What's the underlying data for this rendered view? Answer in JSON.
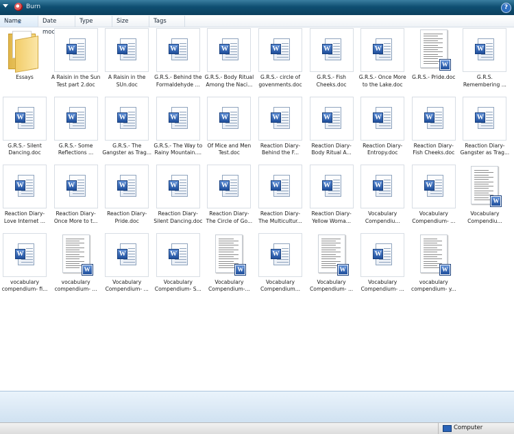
{
  "window": {
    "title": "Burn",
    "help_label": "?"
  },
  "columns": [
    "Name",
    "Date modif...",
    "Type",
    "Size",
    "Tags"
  ],
  "files": [
    {
      "name": "Essays",
      "icon": "folder-icon"
    },
    {
      "name": "A Raisin in the Sun Test part 2.doc",
      "icon": "word-doc-icon"
    },
    {
      "name": "A Raisin in the SUn.doc",
      "icon": "word-doc-icon"
    },
    {
      "name": "G.R.S.- Behind the Formaldehyde ...",
      "icon": "word-doc-icon"
    },
    {
      "name": "G.R.S.- Body Ritual Among the Naci...",
      "icon": "word-doc-icon"
    },
    {
      "name": "G.R.S.- circle of govenments.doc",
      "icon": "word-doc-icon"
    },
    {
      "name": "G.R.S.- Fish Cheeks.doc",
      "icon": "word-doc-icon"
    },
    {
      "name": "G.R.S.- Once More to the Lake.doc",
      "icon": "word-doc-icon"
    },
    {
      "name": "G.R.S.- Pride.doc",
      "icon": "doc-preview-icon"
    },
    {
      "name": "G.R.S. Remembering ...",
      "icon": "word-doc-icon"
    },
    {
      "name": "G.R.S.- Silent Dancing.doc",
      "icon": "word-doc-icon"
    },
    {
      "name": "G.R.S.- Some Reflections ...",
      "icon": "word-doc-icon"
    },
    {
      "name": "G.R.S.- The Gangster as Trag...",
      "icon": "word-doc-icon"
    },
    {
      "name": "G.R.S.- The Way to Rainy Mountain....",
      "icon": "word-doc-icon"
    },
    {
      "name": "Of Mice and Men Test.doc",
      "icon": "word-doc-icon"
    },
    {
      "name": "Reaction Diary- Behind the F...",
      "icon": "word-doc-icon"
    },
    {
      "name": "Reaction Diary- Body Ritual A...",
      "icon": "word-doc-icon"
    },
    {
      "name": "Reaction Diary- Entropy.doc",
      "icon": "word-doc-icon"
    },
    {
      "name": "Reaction Diary- Fish Cheeks.doc",
      "icon": "word-doc-icon"
    },
    {
      "name": "Reaction Diary- Gangster as Trag...",
      "icon": "word-doc-icon"
    },
    {
      "name": "Reaction Diary- Love Internet ...",
      "icon": "word-doc-icon"
    },
    {
      "name": "Reaction Diary- Once More to t...",
      "icon": "word-doc-icon"
    },
    {
      "name": "Reaction Diary- Pride.doc",
      "icon": "word-doc-icon"
    },
    {
      "name": "Reaction Diary- Silent Dancing.doc",
      "icon": "word-doc-icon"
    },
    {
      "name": "Reaction Diary- The Circle of Go...",
      "icon": "word-doc-icon"
    },
    {
      "name": "Reaction Diary- The Multicultur...",
      "icon": "word-doc-icon"
    },
    {
      "name": "Reaction Diary- Yellow Woma...",
      "icon": "word-doc-icon"
    },
    {
      "name": "Vocabulary Compendiu...",
      "icon": "word-doc-icon"
    },
    {
      "name": "Vocabulary Compendium- ...",
      "icon": "word-doc-icon"
    },
    {
      "name": "Vocabulary Compendiu...",
      "icon": "doc-preview-icon"
    },
    {
      "name": "vocabulary compendium- fi...",
      "icon": "word-doc-icon"
    },
    {
      "name": "vocabulary compendium- ...",
      "icon": "doc-preview-icon"
    },
    {
      "name": "Vocabulary Compendium- ...",
      "icon": "word-doc-icon"
    },
    {
      "name": "Vocabulary Compendium- S...",
      "icon": "word-doc-icon"
    },
    {
      "name": "Vocabulary Compendium-...",
      "icon": "doc-preview-icon"
    },
    {
      "name": "Vocabulary Compendium...",
      "icon": "word-doc-icon"
    },
    {
      "name": "Vocabulary Compendium- ...",
      "icon": "doc-preview-icon"
    },
    {
      "name": "Vocabulary Compendium- ...",
      "icon": "word-doc-icon"
    },
    {
      "name": "vocabulary compendium- y...",
      "icon": "doc-preview-icon"
    }
  ],
  "status": {
    "location": "Computer"
  }
}
